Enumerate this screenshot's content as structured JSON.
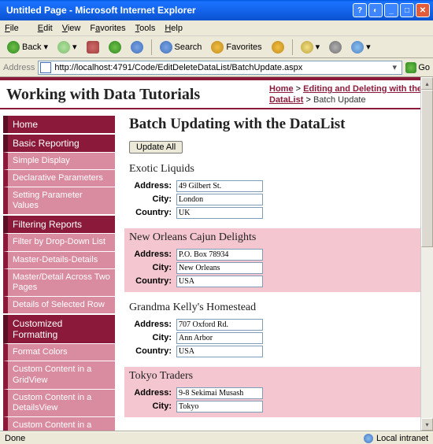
{
  "window": {
    "title": "Untitled Page - Microsoft Internet Explorer"
  },
  "menu": {
    "file": "File",
    "edit": "Edit",
    "view": "View",
    "favorites": "Favorites",
    "tools": "Tools",
    "help": "Help"
  },
  "toolbar": {
    "back": "Back",
    "search": "Search",
    "favorites": "Favorites"
  },
  "address": {
    "label": "Address",
    "url": "http://localhost:4791/Code/EditDeleteDataList/BatchUpdate.aspx",
    "go": "Go"
  },
  "site": {
    "title": "Working with Data Tutorials"
  },
  "breadcrumb": {
    "home": "Home",
    "sep": " > ",
    "section": "Editing and Deleting with the DataList",
    "current": "Batch Update"
  },
  "nav": {
    "home": "Home",
    "cat1": "Basic Reporting",
    "cat1_items": [
      "Simple Display",
      "Declarative Parameters",
      "Setting Parameter Values"
    ],
    "cat2": "Filtering Reports",
    "cat2_items": [
      "Filter by Drop-Down List",
      "Master-Details-Details",
      "Master/Detail Across Two Pages",
      "Details of Selected Row"
    ],
    "cat3": "Customized Formatting",
    "cat3_items": [
      "Format Colors",
      "Custom Content in a GridView",
      "Custom Content in a DetailsView",
      "Custom Content in a"
    ]
  },
  "page": {
    "heading": "Batch Updating with the DataList",
    "update_all": "Update All"
  },
  "labels": {
    "address": "Address:",
    "city": "City:",
    "country": "Country:"
  },
  "suppliers": [
    {
      "name": "Exotic Liquids",
      "address": "49 Gilbert St.",
      "city": "London",
      "country": "UK"
    },
    {
      "name": "New Orleans Cajun Delights",
      "address": "P.O. Box 78934",
      "city": "New Orleans",
      "country": "USA"
    },
    {
      "name": "Grandma Kelly's Homestead",
      "address": "707 Oxford Rd.",
      "city": "Ann Arbor",
      "country": "USA"
    },
    {
      "name": "Tokyo Traders",
      "address": "9-8 Sekimai Musash",
      "city": "Tokyo",
      "country": ""
    }
  ],
  "status": {
    "done": "Done",
    "zone": "Local intranet"
  }
}
